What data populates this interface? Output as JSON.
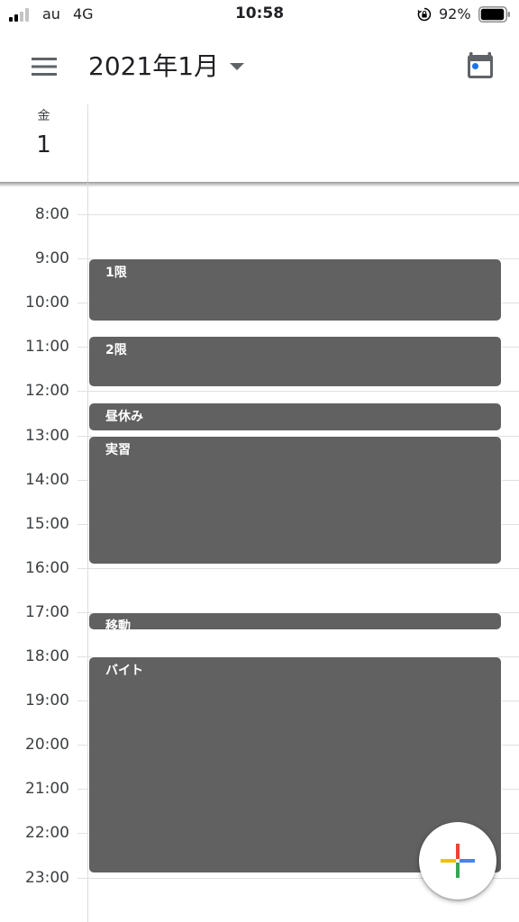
{
  "status_bar": {
    "carrier": "au",
    "network": "4G",
    "time": "10:58",
    "battery": "92%"
  },
  "app_bar": {
    "month_title": "2021年1月",
    "icons": {
      "menu": "hamburger-menu-icon",
      "dropdown": "caret-down-icon",
      "today": "calendar-today-icon"
    }
  },
  "day_header": {
    "weekday": "金",
    "day": "1"
  },
  "timeline": {
    "hours": [
      "8:00",
      "9:00",
      "10:00",
      "11:00",
      "12:00",
      "13:00",
      "14:00",
      "15:00",
      "16:00",
      "17:00",
      "18:00",
      "19:00",
      "20:00",
      "21:00",
      "22:00",
      "23:00"
    ],
    "events": [
      {
        "title": "1限",
        "start": "9:00",
        "end": "10:25"
      },
      {
        "title": "2限",
        "start": "10:45",
        "end": "11:55"
      },
      {
        "title": "昼休み",
        "start": "12:15",
        "end": "12:55"
      },
      {
        "title": "実習",
        "start": "13:00",
        "end": "15:55"
      },
      {
        "title": "移動",
        "start": "17:00",
        "end": "17:25"
      },
      {
        "title": "バイト",
        "start": "18:00",
        "end": "22:55"
      }
    ]
  },
  "fab": {
    "icon": "add-plus-icon"
  },
  "colors": {
    "event_bg": "#616161",
    "event_text": "#ffffff",
    "today_dot": "#1a73e8",
    "plus_red": "#ea4335",
    "plus_blue": "#4285f4",
    "plus_green": "#34a853",
    "plus_yellow": "#fbbc04"
  }
}
